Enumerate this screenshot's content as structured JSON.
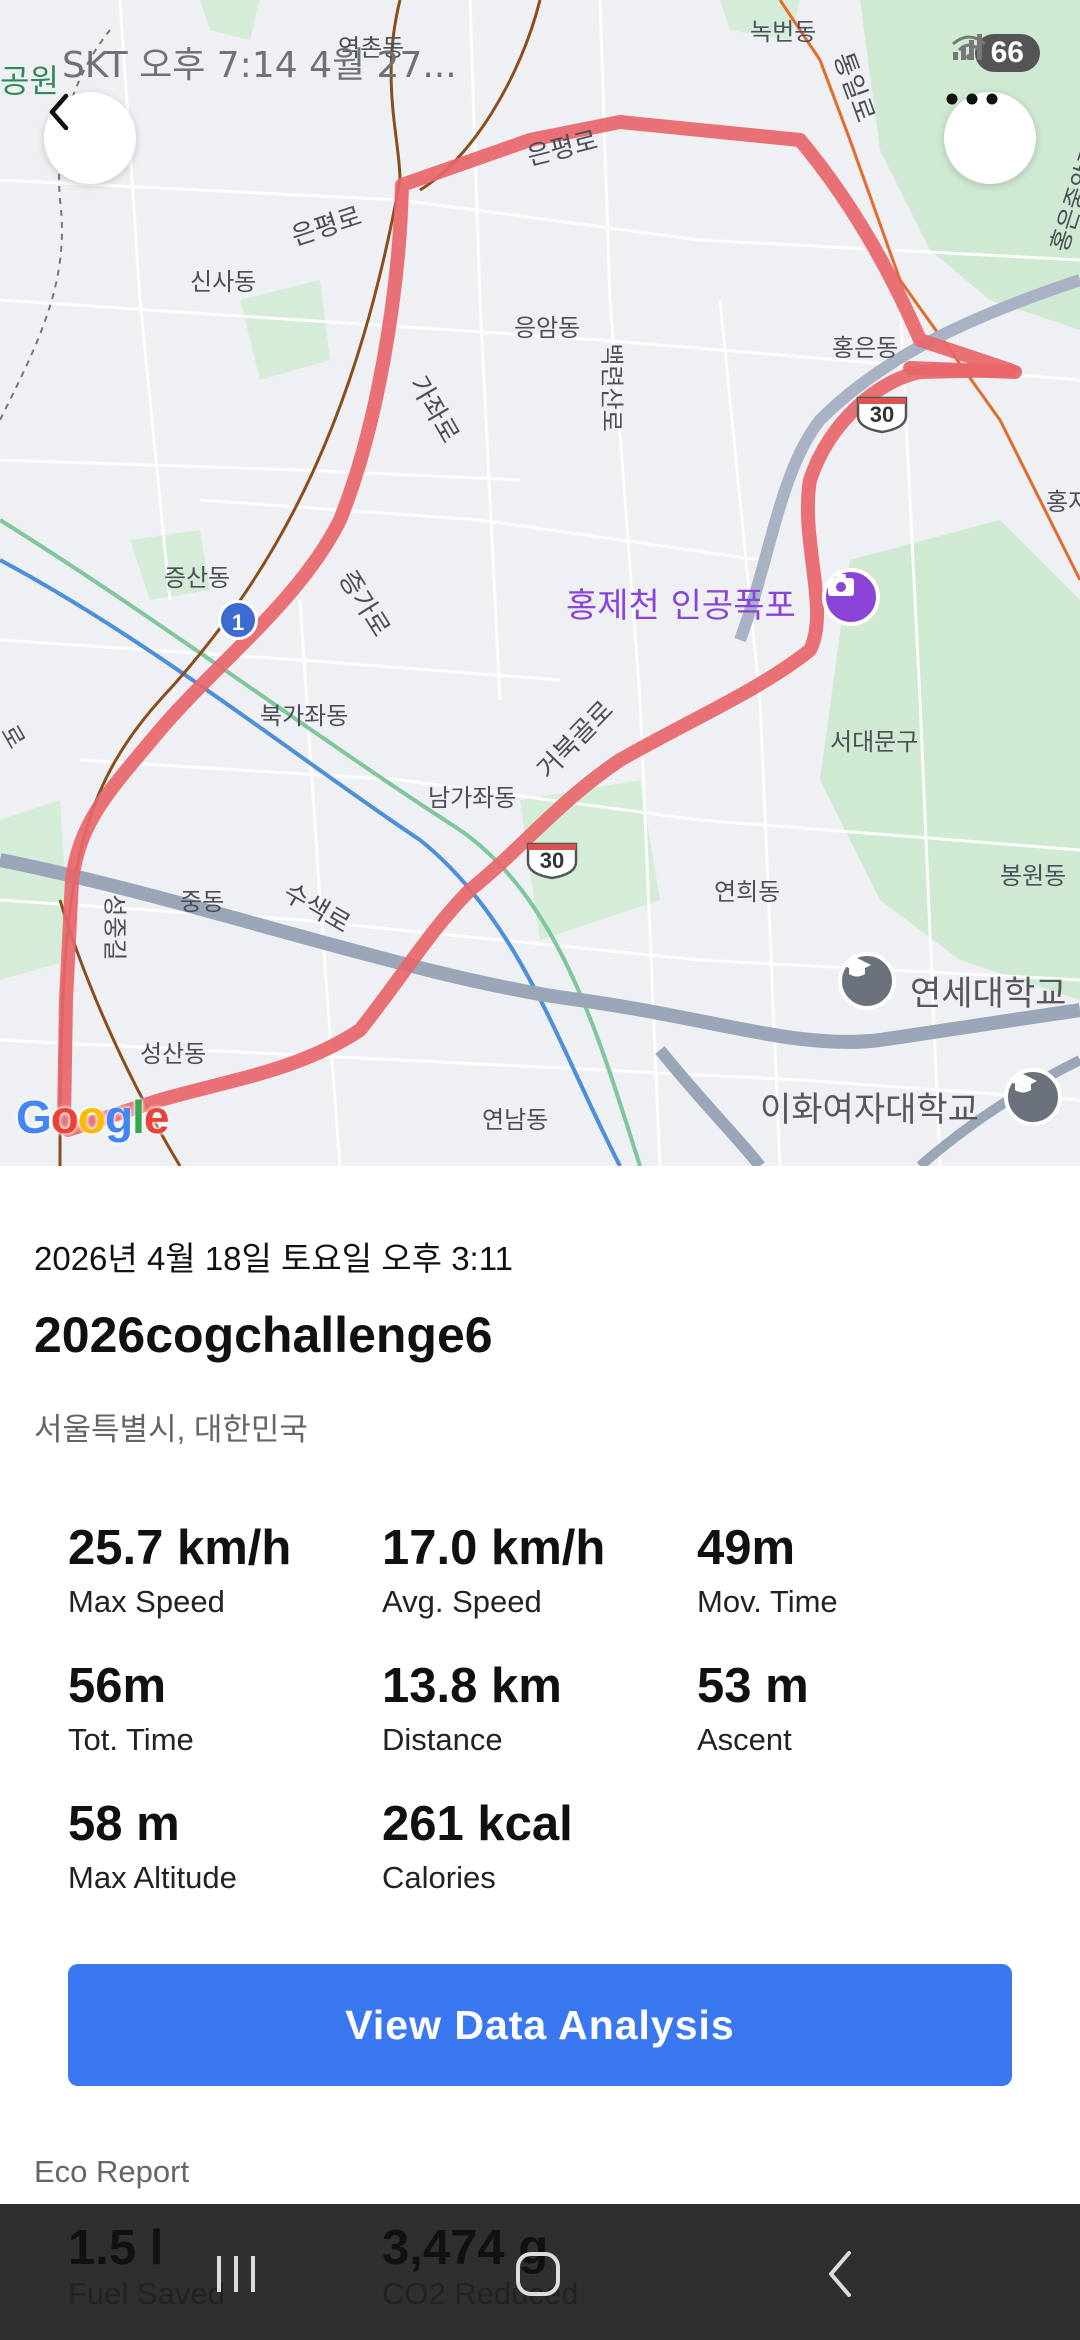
{
  "status_bar": {
    "carrier_time": "SKT 오후 7:14  4월 27...",
    "battery": "66",
    "icons": [
      "wifi-icon",
      "signal-icon"
    ]
  },
  "map": {
    "labels": {
      "noksan": "녹번동",
      "eunpyeong_ro_1": "은평로",
      "eunpyeong_ro_2": "은평로",
      "tongil_ro": "통일로",
      "hongeun_jungang": "홍은중앙로",
      "sinsa": "신사동",
      "eungam": "응암동",
      "gajwa": "가좌로",
      "baengnyeon": "백련산로",
      "hongeun": "홍은동",
      "hong_edge": "홍자",
      "jeungsan": "증산동",
      "jeungga": "증가로",
      "bukgajwa": "북가좌동",
      "geobukgol": "거북골로",
      "seodaemun": "서대문구",
      "namgajwa": "남가좌동",
      "yeonhui": "연희동",
      "bongwon": "봉원동",
      "jung": "중동",
      "susaek": "수색로",
      "seongjung": "성중길",
      "seongsan": "성산동",
      "yeonnam": "연남동",
      "park_edge": "공원",
      "yeokchon": "역촌동",
      "left_edge": "로"
    },
    "poi": {
      "waterfall": "홍제천 인공폭포",
      "yonsei": "연세대학교",
      "ewha": "이화여자대학교"
    },
    "shields": {
      "route_30_a": "30",
      "route_30_b": "30"
    },
    "route_badge": "1",
    "attribution": [
      "G",
      "o",
      "o",
      "g",
      "l",
      "e"
    ]
  },
  "activity": {
    "date": "2026년 4월 18일 토요일 오후 3:11",
    "title": "2026cogchallenge6",
    "location": "서울특별시, 대한민국"
  },
  "stats": [
    {
      "value": "25.7 km/h",
      "label": "Max Speed"
    },
    {
      "value": "17.0 km/h",
      "label": "Avg. Speed"
    },
    {
      "value": "49m",
      "label": "Mov. Time"
    },
    {
      "value": "56m",
      "label": "Tot. Time"
    },
    {
      "value": "13.8 km",
      "label": "Distance"
    },
    {
      "value": "53 m",
      "label": "Ascent"
    },
    {
      "value": "58 m",
      "label": "Max Altitude"
    },
    {
      "value": "261 kcal",
      "label": "Calories"
    }
  ],
  "analysis_button": "View Data Analysis",
  "eco_report": {
    "heading": "Eco Report",
    "items": [
      {
        "value": "1.5 l",
        "label": "Fuel Saved"
      },
      {
        "value": "3,474 g",
        "label": "CO2 Reduced"
      }
    ]
  },
  "colors": {
    "accent": "#3a78f2",
    "route": "#e8666a",
    "poi_purple": "#8a45d8"
  }
}
